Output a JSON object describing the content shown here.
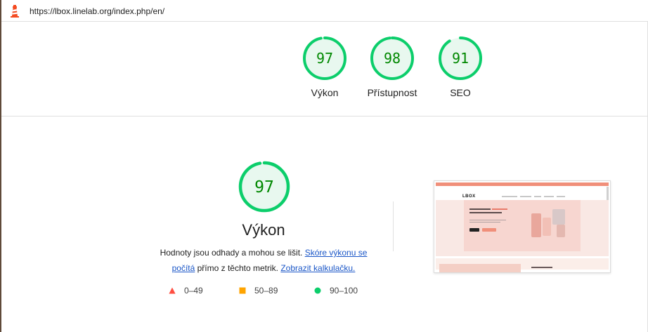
{
  "header": {
    "url": "https://lbox.linelab.org/index.php/en/",
    "icon": "lighthouse-icon"
  },
  "colors": {
    "pass": "#0cce6b",
    "pass_text": "#008800",
    "pass_bg": "#e8f8ef",
    "average": "#ffa400",
    "fail": "#ff4e42",
    "link": "#1a56c7"
  },
  "summary_gauges": [
    {
      "score": "97",
      "label": "Výkon"
    },
    {
      "score": "98",
      "label": "Přístupnost"
    },
    {
      "score": "91",
      "label": "SEO"
    }
  ],
  "performance": {
    "score": "97",
    "title": "Výkon",
    "description_prefix": "Hodnoty jsou odhady a mohou se lišit. ",
    "link_scoring": "Skóre výkonu se počítá",
    "description_middle": " přímo z těchto metrik. ",
    "link_calculator": "Zobrazit kalkulačku."
  },
  "legend": [
    {
      "range": "0–49",
      "icon": "red-triangle-icon"
    },
    {
      "range": "50–89",
      "icon": "orange-square-icon"
    },
    {
      "range": "90–100",
      "icon": "green-circle-icon"
    }
  ],
  "thumbnail": {
    "logo": "LBOX"
  }
}
